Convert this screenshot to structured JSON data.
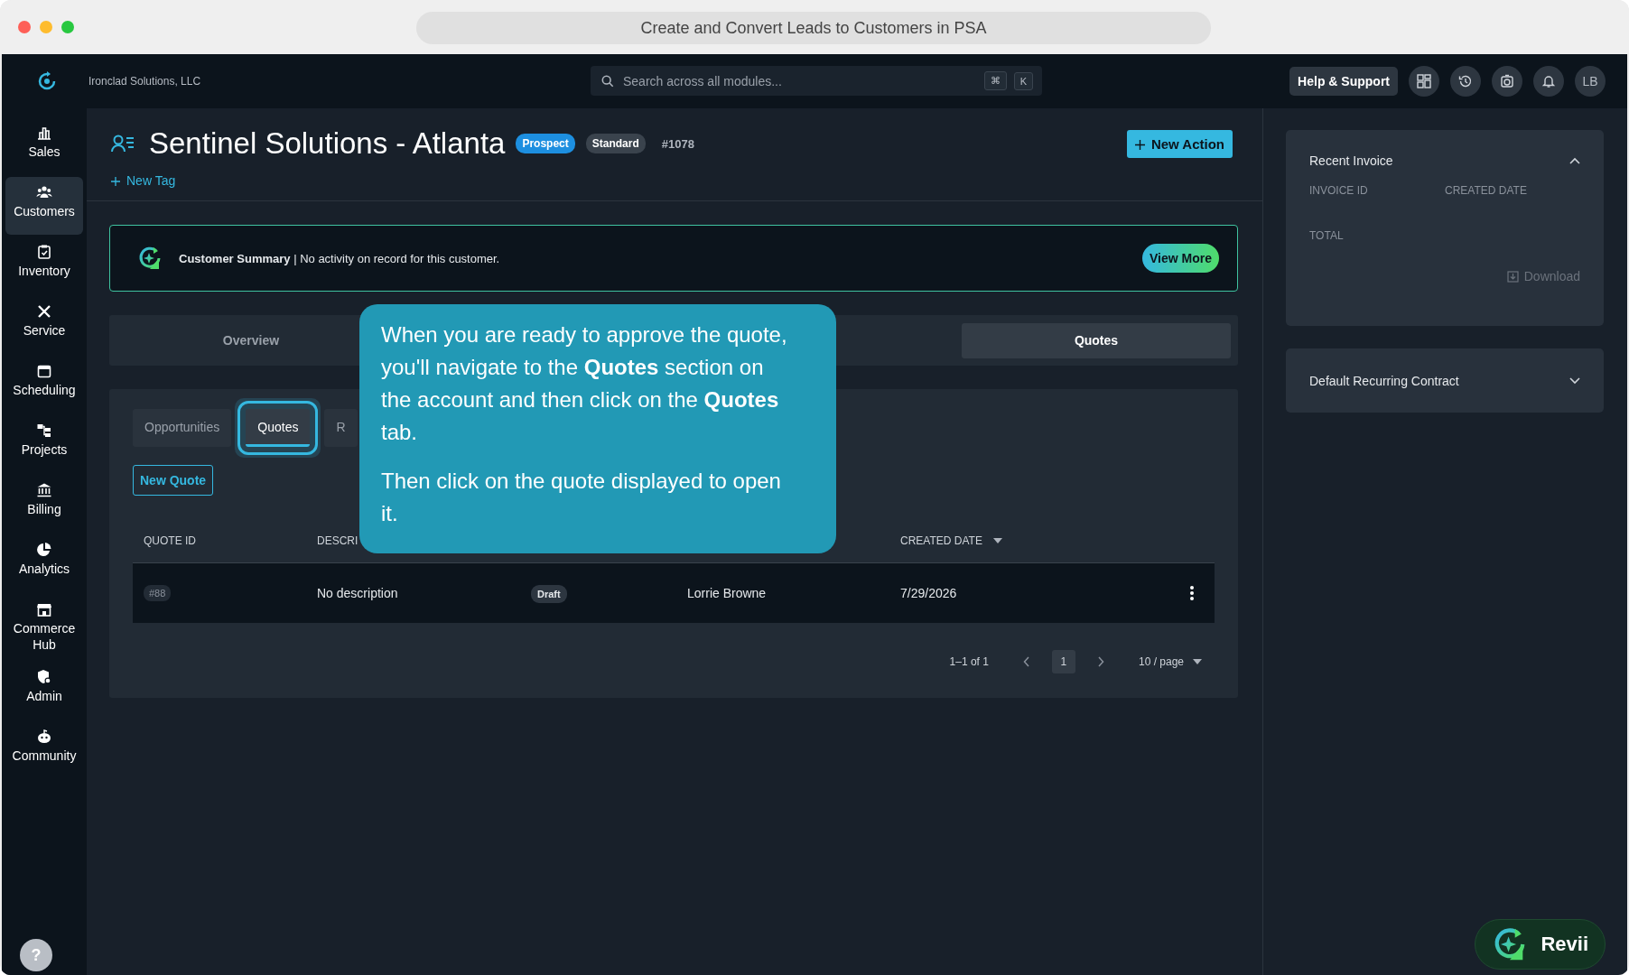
{
  "window": {
    "title": "Create and Convert Leads to Customers in PSA"
  },
  "topbar": {
    "company": "Ironclad Solutions, LLC",
    "search_placeholder": "Search across all modules...",
    "shortcut_keys": [
      "⌘",
      "K"
    ],
    "help_button": "Help & Support",
    "avatar": "LB"
  },
  "sidebar": {
    "items": [
      {
        "label": "Sales",
        "selected": false
      },
      {
        "label": "Customers",
        "selected": true
      },
      {
        "label": "Inventory",
        "selected": false
      },
      {
        "label": "Service",
        "selected": false
      },
      {
        "label": "Scheduling",
        "selected": false
      },
      {
        "label": "Projects",
        "selected": false
      },
      {
        "label": "Billing",
        "selected": false
      },
      {
        "label": "Analytics",
        "selected": false
      },
      {
        "label": "Commerce Hub",
        "selected": false
      },
      {
        "label": "Admin",
        "selected": false
      },
      {
        "label": "Community",
        "selected": false
      }
    ],
    "help": "?"
  },
  "account": {
    "name": "Sentinel Solutions - Atlanta",
    "badges": [
      {
        "label": "Prospect",
        "kind": "status"
      },
      {
        "label": "Standard",
        "kind": "tier"
      }
    ],
    "number": "#1078",
    "new_action": "New Action",
    "new_tag": "New Tag"
  },
  "summary": {
    "text": "**Customer Summary** | No activity on record for this customer.",
    "button": "View More"
  },
  "main_tabs": [
    {
      "label": "Overview",
      "selected": false
    },
    {
      "label": "Quotes",
      "selected": true
    }
  ],
  "sub_tabs": [
    {
      "label": "Opportunities",
      "selected": false
    },
    {
      "label": "Quotes",
      "selected": true
    },
    {
      "label": "R",
      "selected": false
    }
  ],
  "new_quote": "New Quote",
  "table": {
    "columns": [
      {
        "label": "QUOTE ID",
        "sorted": false
      },
      {
        "label": "DESCRI",
        "sorted": false
      },
      {
        "label": "CREATED DATE",
        "sorted": true
      }
    ],
    "rows": [
      {
        "quote_id": "#88",
        "description": "No description",
        "status": "Draft",
        "contact": "Lorrie Browne",
        "created": "7/29/2026"
      }
    ]
  },
  "pagination": {
    "range": "1–1 of 1",
    "pages": [
      {
        "label": "1",
        "selected": true
      }
    ],
    "page_size": "10 / page"
  },
  "recent_invoice": {
    "title": "Recent Invoice",
    "expanded": true,
    "fields": [
      "INVOICE ID",
      "CREATED DATE",
      "TOTAL"
    ],
    "download": "Download"
  },
  "contract": {
    "title": "Default Recurring Contract",
    "expanded": false
  },
  "tooltip": {
    "paragraphs": [
      "When you are ready to approve the quote, you'll navigate to the **Quotes** section on the account and then click on the **Quotes** tab.",
      "Then click on the quote displayed to open it."
    ]
  },
  "assistant": {
    "label": "Revii"
  }
}
